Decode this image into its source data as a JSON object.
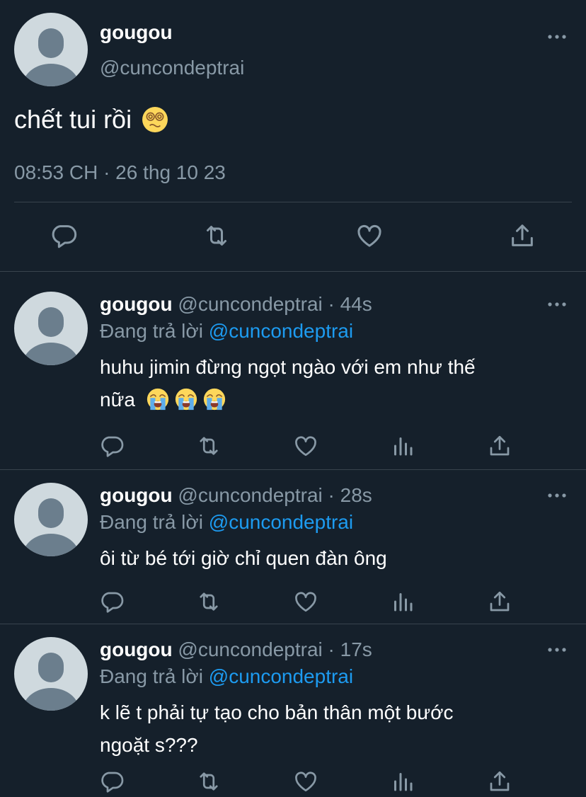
{
  "main_tweet": {
    "name": "gougou",
    "handle": "@cuncondeptrai",
    "text": "chết tui rồi",
    "emoji": "dizzy-face-emoji",
    "timestamp": "08:53 CH · 26 thg 10 23",
    "actions": [
      "reply-icon",
      "retweet-icon",
      "like-icon",
      "share-icon"
    ]
  },
  "replies": [
    {
      "name": "gougou",
      "handle": "@cuncondeptrai",
      "separator": "·",
      "time": "44s",
      "replying_label": "Đang trả lời",
      "replying_to": "@cuncondeptrai",
      "text_line1": "huhu jimin đừng ngọt ngào với em như thế",
      "text_line2": "nữa",
      "emojis": [
        "loudly-crying-face-emoji",
        "loudly-crying-face-emoji",
        "loudly-crying-face-emoji"
      ]
    },
    {
      "name": "gougou",
      "handle": "@cuncondeptrai",
      "separator": "·",
      "time": "28s",
      "replying_label": "Đang trả lời",
      "replying_to": "@cuncondeptrai",
      "text_line1": "ôi từ bé tới giờ chỉ quen đàn ông",
      "text_line2": ""
    },
    {
      "name": "gougou",
      "handle": "@cuncondeptrai",
      "separator": "·",
      "time": "17s",
      "replying_label": "Đang trả lời",
      "replying_to": "@cuncondeptrai",
      "text_line1": "k lẽ t phải tự tạo cho bản thân một bước",
      "text_line2": "ngoặt s???"
    }
  ],
  "reply_actions": [
    "reply-icon",
    "retweet-icon",
    "like-icon",
    "views-icon",
    "share-icon"
  ],
  "colors": {
    "background": "#15202b",
    "text": "#ffffff",
    "secondary": "#8899a6",
    "link": "#1d9bf0",
    "divider": "#38444d",
    "avatar_bg": "#cfd9de",
    "avatar_fg": "#6b7e8d"
  }
}
